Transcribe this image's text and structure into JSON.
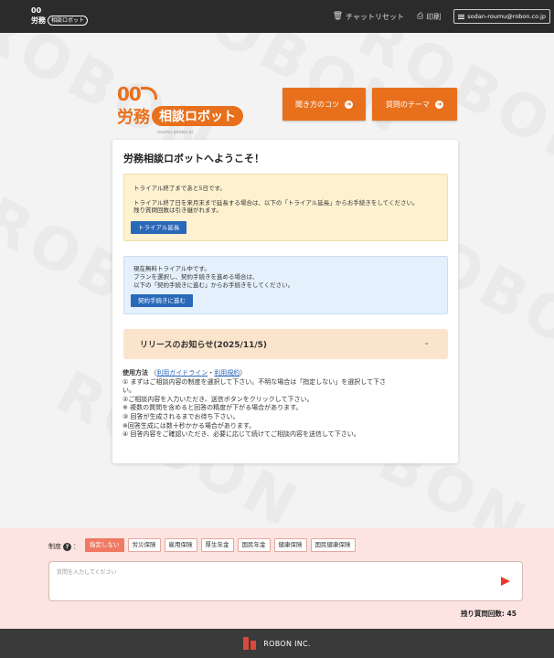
{
  "topbar": {
    "logo_oo": "00",
    "logo_k1": "労務",
    "logo_pill": "相談ロボット",
    "chat_reset": "チャットリセット",
    "print": "印刷",
    "email": "sodan-roumu@robon.co.jp"
  },
  "header": {
    "logo_oo": "00",
    "logo_k": "労務",
    "logo_pill": "相談ロボット",
    "logo_sub": "roumu.sodan.ai",
    "tips_button": "聞き方のコツ",
    "theme_button": "質問のテーマ"
  },
  "card": {
    "title": "労務相談ロボットへようこそ！",
    "trial": {
      "line1": "トライアル終了まであと5日です。",
      "line2": "トライアル終了日を来月末まで延長する場合は、以下の「トライアル延長」からお手続きをしてください。",
      "line3": "残り質問回数は引き継がれます。",
      "button": "トライアル延長"
    },
    "contract": {
      "line1": "現在無料トライアル中です。",
      "line2": "プランを選択し、契約手続きを進める場合は、",
      "line3": "以下の「契約手続きに進む」からお手続きをしてください。",
      "button": "契約手続きに進む"
    },
    "release": {
      "title": "リリースのお知らせ(2025/11/5)"
    },
    "usage": {
      "label": "使用方法",
      "paren_open": "（",
      "guide_link": "利用ガイドライン",
      "sep": "・",
      "terms_link": "利用規約",
      "paren_close": "）",
      "lines": [
        "① まずはご相談内容の制度を選択して下さい。不明な場合は「指定しない」を選択して下さ",
        "い。",
        "②ご相談内容を入力いただき、送信ボタンをクリックして下さい。",
        "※ 複数の質問を含めると回答の精度が下がる場合があります。",
        "③ 回答が生成されるまでお待ち下さい。",
        "※回答生成には数十秒かかる場合があります。",
        "④ 回答内容をご確認いただき、必要に応じて続けてご相談内容を送信して下さい。"
      ]
    }
  },
  "bottom": {
    "system_label": "制度",
    "system_colon": "：",
    "chips": [
      "指定しない",
      "労災保険",
      "雇用保険",
      "厚生年金",
      "国民年金",
      "健康保険",
      "国民健康保険"
    ],
    "input_placeholder": "質問を入力してください",
    "remaining": "残り質問回数: 45"
  },
  "footer": {
    "company": "ROBON INC."
  },
  "watermark": "ROBON",
  "colors": {
    "accent": "#e8701d",
    "active_chip": "#f07962",
    "send": "#e8392a"
  }
}
